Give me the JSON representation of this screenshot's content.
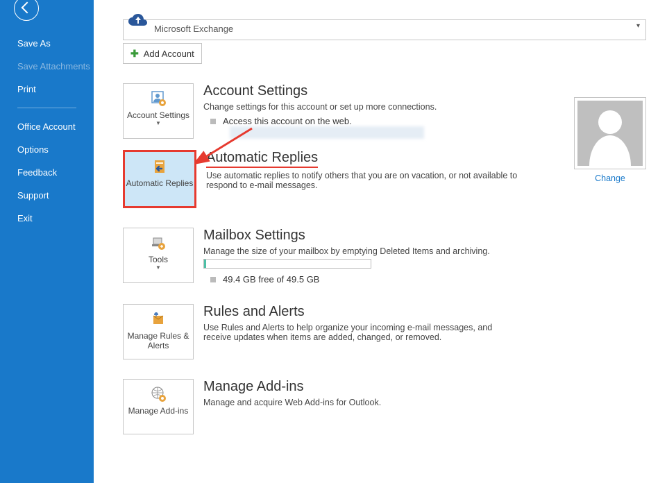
{
  "sidebar": {
    "items": [
      {
        "label": "Save As",
        "disabled": false
      },
      {
        "label": "Save Attachments",
        "disabled": true
      },
      {
        "label": "Print",
        "disabled": false
      }
    ],
    "items2": [
      {
        "label": "Office Account"
      },
      {
        "label": "Options"
      },
      {
        "label": "Feedback"
      },
      {
        "label": "Support"
      },
      {
        "label": "Exit"
      }
    ]
  },
  "account_bar": {
    "service": "Microsoft Exchange"
  },
  "add_account": {
    "label": "Add Account"
  },
  "avatar": {
    "change": "Change"
  },
  "sections": {
    "account_settings": {
      "tile": "Account Settings",
      "title": "Account Settings",
      "desc": "Change settings for this account or set up more connections.",
      "link": "Access this account on the web."
    },
    "automatic_replies": {
      "tile": "Automatic Replies",
      "title": "Automatic Replies",
      "desc": "Use automatic replies to notify others that you are on vacation, or not available to respond to e-mail messages."
    },
    "mailbox": {
      "tile": "Tools",
      "title": "Mailbox Settings",
      "desc": "Manage the size of your mailbox by emptying Deleted Items and archiving.",
      "quota": "49.4 GB free of 49.5 GB"
    },
    "rules": {
      "tile": "Manage Rules & Alerts",
      "title": "Rules and Alerts",
      "desc": "Use Rules and Alerts to help organize your incoming e-mail messages, and receive updates when items are added, changed, or removed."
    },
    "addins": {
      "tile": "Manage Add-ins",
      "title": "Manage Add-ins",
      "desc": "Manage and acquire Web Add-ins for Outlook."
    }
  }
}
